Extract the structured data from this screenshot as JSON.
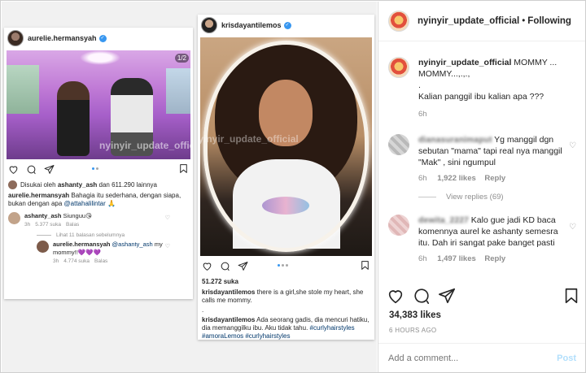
{
  "left_card": {
    "username": "aurelie.hermansyah",
    "photo_counter": "1/2",
    "watermark": "nyinyir_update_official",
    "liked_by_prefix": "Disukai oleh",
    "liked_by_user": "ashanty_ash",
    "liked_by_suffix": "dan 611.290 lainnya",
    "caption_user": "aurelie.hermansyah",
    "caption_text": "Bahagia itu sederhana, dengan siapa, bukan dengan apa",
    "caption_mention": "@attahalilintar",
    "caption_emoji": "🙏",
    "comment1_user": "ashanty_ash",
    "comment1_text": "Siunguu😘",
    "comment1_time": "3h",
    "comment1_likes": "5.377 suka",
    "comment1_reply": "Balas",
    "view_replies": "Lihat 11 balasan sebelumnya",
    "reply1_user": "aurelie.hermansyah",
    "reply1_mention": "@ashanty_ash",
    "reply1_text": "my mommy!!💜💜💜",
    "reply1_time": "3h",
    "reply1_likes": "4.774 suka",
    "reply1_reply": "Balas"
  },
  "mid_card": {
    "username": "krisdayantilemos",
    "likes": "51.272 suka",
    "caption1_user": "krisdayantilemos",
    "caption1_text": "there is a girl,she stole my heart, she calls me mommy.",
    "separator": ".",
    "caption2_user": "krisdayantilemos",
    "caption2_text": "Ada seorang gadis, dia mencuri hatiku, dia memanggilku ibu. Aku tidak tahu.",
    "caption2_tags1": "#curlyhairstyles",
    "caption2_tags2": "#amoraLemos #curlyhairstyles"
  },
  "right_panel": {
    "header": {
      "username": "nyinyir_update_official",
      "separator": "•",
      "follow_status": "Following"
    },
    "post_caption": {
      "username": "nyinyir_update_official",
      "line1": "MOMMY ...",
      "line2": "MOMMY...,.,.,",
      "line3": ".",
      "line4": "Kalian panggil ibu kalian apa ???",
      "time": "6h"
    },
    "comments": [
      {
        "username": "dianasuranimaput",
        "text": "Yg manggil dgn sebutan \"mama\" tapi real nya manggil \"Mak\" , sini ngumpul",
        "time": "6h",
        "likes": "1,922 likes",
        "reply": "Reply",
        "view_replies": "View replies (69)"
      },
      {
        "username": "dewita_2227",
        "text": "Kalo gue jadi KD baca komennya aurel ke ashanty semesra itu. Dah iri sangat pake banget pasti",
        "time": "6h",
        "likes": "1,497 likes",
        "reply": "Reply"
      }
    ],
    "likes": "34,383 likes",
    "timestamp": "6 HOURS AGO",
    "add_comment_placeholder": "Add a comment...",
    "post_button": "Post"
  },
  "colors": {
    "link": "#00376b",
    "muted": "#8e8e8e",
    "verified": "#3897f0",
    "post_disabled": "#b2dffc"
  },
  "icons": [
    "heart-icon",
    "comment-icon",
    "share-icon",
    "bookmark-icon",
    "verified-badge-icon"
  ]
}
